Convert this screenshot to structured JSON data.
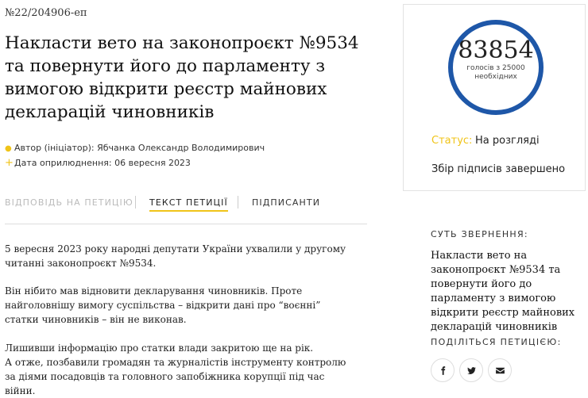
{
  "petition": {
    "number": "№22/204906-еп",
    "title": "Накласти вето на законопроєкт №9534 та повернути його до парламенту з вимогою відкрити реєстр майнових декларацій чиновників",
    "author": "Автор (ініціатор): Ябчанка Олександр Володимирович",
    "published": "Дата оприлюднення: 06 вересня 2023"
  },
  "tabs": [
    {
      "label": "ВІДПОВІДЬ НА ПЕТИЦІЮ",
      "state": "inactive"
    },
    {
      "label": "ТЕКСТ ПЕТИЦІЇ",
      "state": "active"
    },
    {
      "label": "ПІДПИСАНТИ",
      "state": "normal"
    }
  ],
  "content": {
    "paragraphs": [
      "5 вересня 2023 року народні депутати України ухвалили у другому читанні законопроєкт №9534.",
      "Він нібито мав відновити декларування чиновників. Проте найголовнішу вимогу суспільства – відкрити дані про “воєнні” статки чиновників – він не виконав.",
      "Лишивши інформацію про статки влади закритою ще на рік.",
      "А отже, позбавили громадян та журналістів інструменту контролю за діями посадовців та головного запобіжника корупції під час війни."
    ]
  },
  "votes": {
    "count": "83854",
    "note_line1": "голосів з 25000",
    "note_line2": "необхідних"
  },
  "status": {
    "label": "Статус:",
    "value": "На розгляді",
    "note": "Збір підписів завершено"
  },
  "sidebar": {
    "summary_heading": "СУТЬ ЗВЕРНЕННЯ:",
    "summary_text": "Накласти вето на законопроєкт №9534 та повернути його до парламенту з вимогою відкрити реєстр майнових декларацій чиновників",
    "share_heading": "ПОДІЛІТЬСЯ ПЕТИЦІЄЮ:"
  },
  "share_icons": [
    "facebook-icon",
    "twitter-icon",
    "email-icon"
  ],
  "colors": {
    "accent": "#f0c419",
    "ring": "#1e57a8"
  }
}
